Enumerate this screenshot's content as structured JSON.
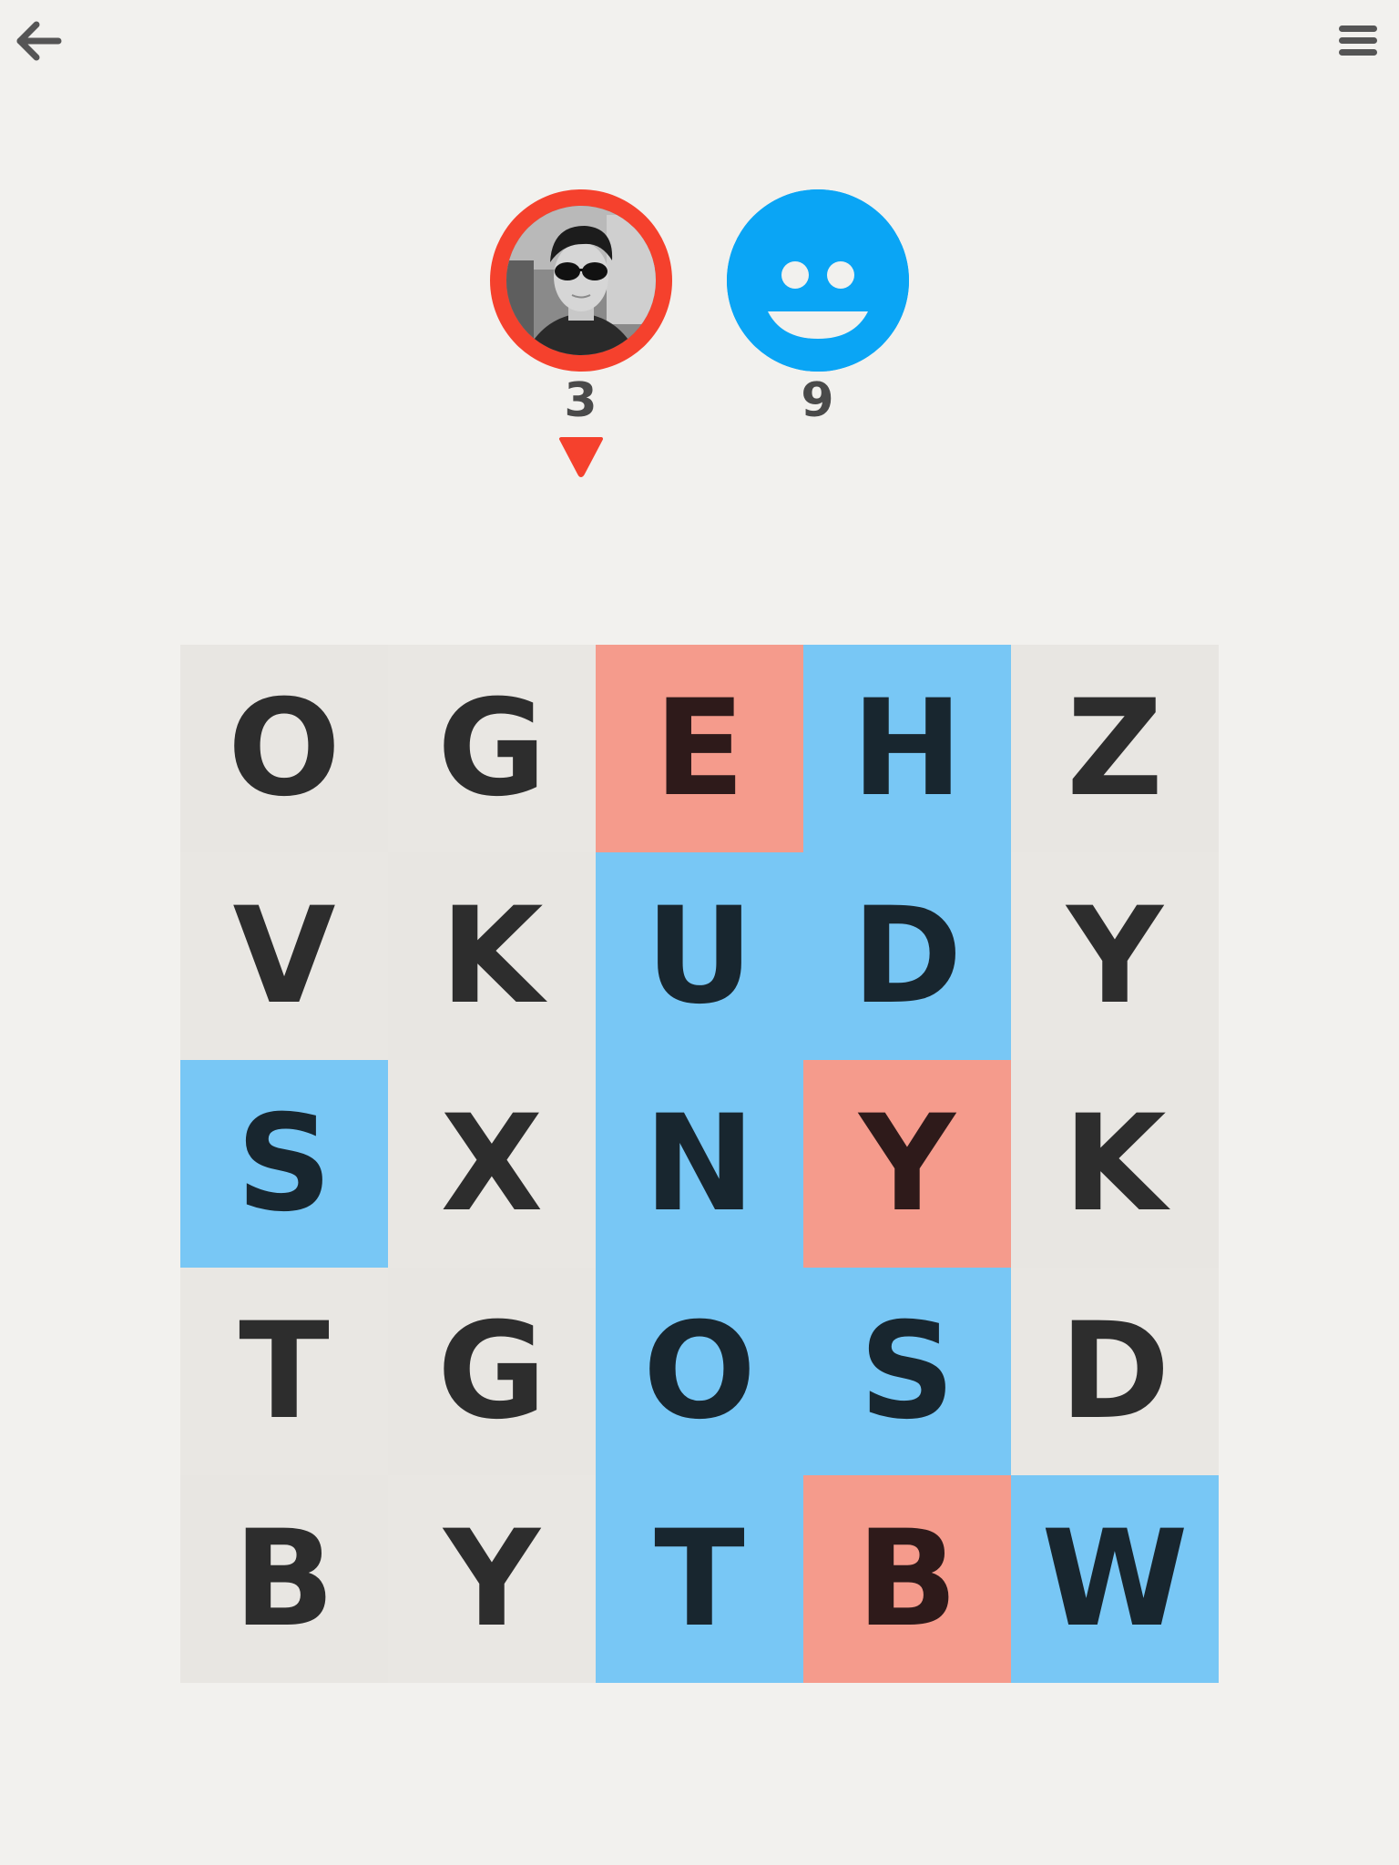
{
  "header": {
    "back_icon": "arrow-left-icon",
    "menu_icon": "hamburger-menu-icon",
    "icon_color": "#555555"
  },
  "players": {
    "player": {
      "avatar": "user-photo-avatar",
      "ring_color": "#f5412d",
      "score": "3",
      "is_turn": true
    },
    "opponent": {
      "avatar": "smiley-face-icon",
      "color": "#0aa5f5",
      "score": "9"
    }
  },
  "colors": {
    "neutral": "#e8e6e2",
    "blue_owned": "#78c7f5",
    "red_owned": "#f59b8c",
    "turn_indicator": "#f5412d",
    "background": "#f2f1ee"
  },
  "board": {
    "rows": [
      [
        {
          "letter": "O",
          "state": "neutral"
        },
        {
          "letter": "G",
          "state": "neutral"
        },
        {
          "letter": "E",
          "state": "red"
        },
        {
          "letter": "H",
          "state": "blue"
        },
        {
          "letter": "Z",
          "state": "neutral"
        }
      ],
      [
        {
          "letter": "V",
          "state": "neutral"
        },
        {
          "letter": "K",
          "state": "neutral"
        },
        {
          "letter": "U",
          "state": "blue"
        },
        {
          "letter": "D",
          "state": "blue"
        },
        {
          "letter": "Y",
          "state": "neutral"
        }
      ],
      [
        {
          "letter": "S",
          "state": "blue"
        },
        {
          "letter": "X",
          "state": "neutral"
        },
        {
          "letter": "N",
          "state": "blue"
        },
        {
          "letter": "Y",
          "state": "red"
        },
        {
          "letter": "K",
          "state": "neutral"
        }
      ],
      [
        {
          "letter": "T",
          "state": "neutral"
        },
        {
          "letter": "G",
          "state": "neutral"
        },
        {
          "letter": "O",
          "state": "blue"
        },
        {
          "letter": "S",
          "state": "blue"
        },
        {
          "letter": "D",
          "state": "neutral"
        }
      ],
      [
        {
          "letter": "B",
          "state": "neutral"
        },
        {
          "letter": "Y",
          "state": "neutral"
        },
        {
          "letter": "T",
          "state": "blue"
        },
        {
          "letter": "B",
          "state": "red"
        },
        {
          "letter": "W",
          "state": "blue"
        }
      ]
    ]
  }
}
